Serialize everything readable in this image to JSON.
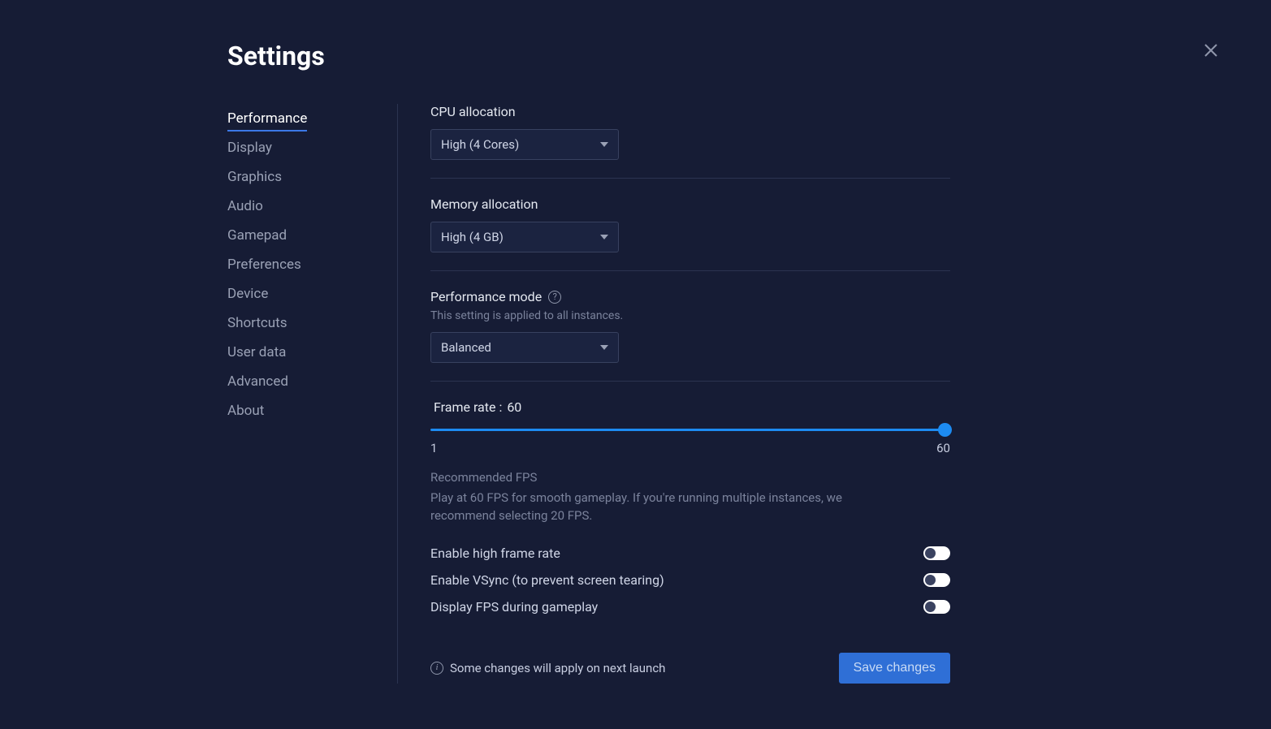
{
  "title": "Settings",
  "sidebar": {
    "items": [
      {
        "label": "Performance",
        "active": true
      },
      {
        "label": "Display",
        "active": false
      },
      {
        "label": "Graphics",
        "active": false
      },
      {
        "label": "Audio",
        "active": false
      },
      {
        "label": "Gamepad",
        "active": false
      },
      {
        "label": "Preferences",
        "active": false
      },
      {
        "label": "Device",
        "active": false
      },
      {
        "label": "Shortcuts",
        "active": false
      },
      {
        "label": "User data",
        "active": false
      },
      {
        "label": "Advanced",
        "active": false
      },
      {
        "label": "About",
        "active": false
      }
    ]
  },
  "cpu": {
    "label": "CPU allocation",
    "value": "High (4 Cores)"
  },
  "memory": {
    "label": "Memory allocation",
    "value": "High (4 GB)"
  },
  "mode": {
    "label": "Performance mode",
    "hint": "This setting is applied to all instances.",
    "value": "Balanced"
  },
  "framerate": {
    "label": "Frame rate :",
    "value": "60",
    "min": "1",
    "max": "60",
    "rec_heading": "Recommended FPS",
    "rec_text": "Play at 60 FPS for smooth gameplay. If you're running multiple instances, we recommend selecting 20 FPS."
  },
  "toggles": {
    "high_fps": {
      "label": "Enable high frame rate",
      "on": false
    },
    "vsync": {
      "label": "Enable VSync (to prevent screen tearing)",
      "on": false
    },
    "show_fps": {
      "label": "Display FPS during gameplay",
      "on": false
    }
  },
  "footer": {
    "note": "Some changes will apply on next launch",
    "save_label": "Save changes"
  }
}
